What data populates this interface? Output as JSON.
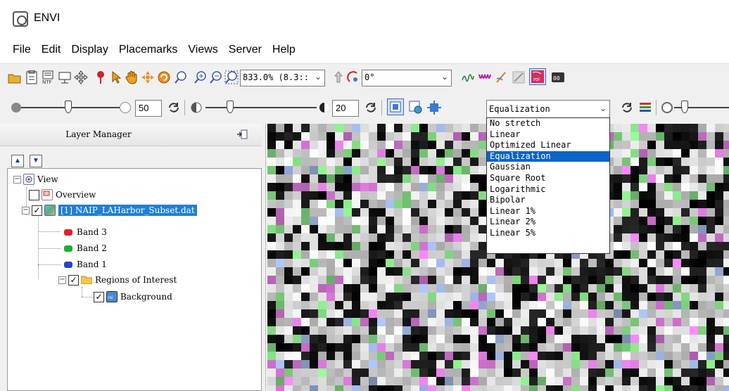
{
  "window": {
    "title": "ENVI"
  },
  "menu": [
    "File",
    "Edit",
    "Display",
    "Placemarks",
    "Views",
    "Server",
    "Help"
  ],
  "toolbar1": {
    "zoom_value": "833.0% (8.3::",
    "rotation_value": "0°"
  },
  "toolbar2": {
    "brightness_value": "50",
    "contrast_value": "20",
    "stretch_selected": "Equalization"
  },
  "stretch_options": [
    "No stretch",
    "Linear",
    "Optimized Linear",
    "Equalization",
    "Gaussian",
    "Square Root",
    "Logarithmic",
    "Bipolar",
    "Linear 1%",
    "Linear 2%",
    "Linear 5%"
  ],
  "layer_manager": {
    "title": "Layer Manager",
    "tree": {
      "view": "View",
      "overview": "Overview",
      "layer": "[1] NAIP_LAHarbor_Subset.dat",
      "bands": [
        {
          "label": "Band 3",
          "color": "#e0202a"
        },
        {
          "label": "Band 2",
          "color": "#1fae2e"
        },
        {
          "label": "Band 1",
          "color": "#2546c8"
        }
      ],
      "roi_folder": "Regions of Interest",
      "roi_item": "Background"
    }
  },
  "colors": {
    "selection": "#0b64c6",
    "tree_highlight": "#1e7fd8"
  }
}
